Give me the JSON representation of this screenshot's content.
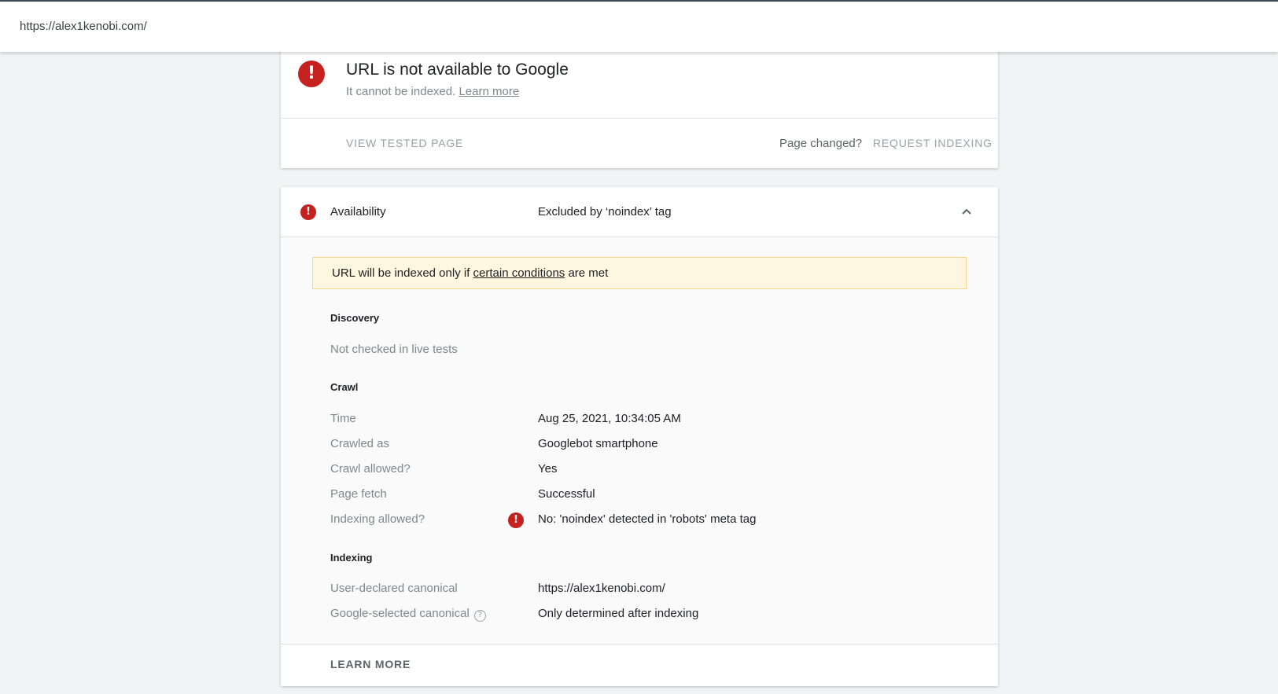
{
  "topbar": {
    "url": "https://alex1kenobi.com/"
  },
  "status_card": {
    "title": "URL is not available to Google",
    "subtitle": "It cannot be indexed.",
    "learn_more_link": "Learn more",
    "view_tested_page": "VIEW TESTED PAGE",
    "page_changed": "Page changed?",
    "request_indexing": "REQUEST INDEXING"
  },
  "availability": {
    "label": "Availability",
    "value": "Excluded by ‘noindex’ tag",
    "notice": {
      "prefix": "URL will be indexed only if",
      "link": "certain conditions",
      "suffix": "are met"
    },
    "discovery": {
      "heading": "Discovery",
      "text": "Not checked in live tests"
    },
    "crawl": {
      "heading": "Crawl",
      "rows": [
        {
          "label": "Time",
          "value": "Aug 25, 2021, 10:34:05 AM"
        },
        {
          "label": "Crawled as",
          "value": "Googlebot smartphone"
        },
        {
          "label": "Crawl allowed?",
          "value": "Yes"
        },
        {
          "label": "Page fetch",
          "value": "Successful"
        },
        {
          "label": "Indexing allowed?",
          "value": "No: 'noindex' detected in 'robots' meta tag"
        }
      ]
    },
    "indexing": {
      "heading": "Indexing",
      "rows": [
        {
          "label": "User-declared canonical",
          "value": "https://alex1kenobi.com/"
        },
        {
          "label": "Google-selected canonical",
          "value": "Only determined after indexing"
        }
      ]
    },
    "learn_more": "LEARN MORE"
  },
  "colors": {
    "error": "#c5221f",
    "notice_bg": "#fef7e0",
    "page_bg": "#f1f3f4"
  },
  "icons": {
    "error": "error-icon",
    "collapse": "chevron-up-icon",
    "help": "help-circle-icon"
  }
}
